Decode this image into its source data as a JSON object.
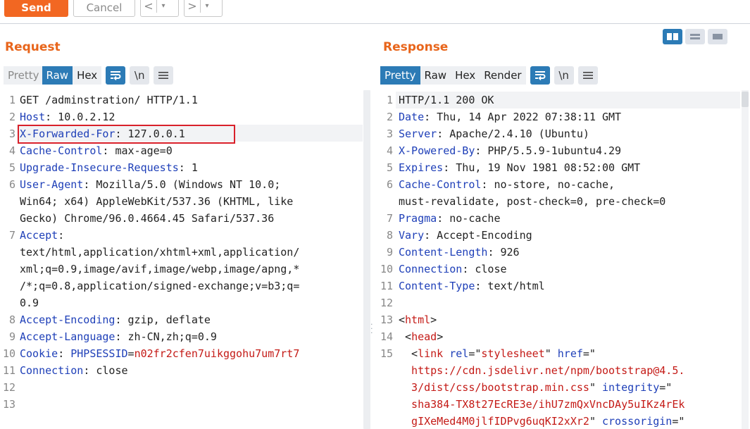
{
  "toolbar": {
    "send_label": "Send",
    "cancel_label": "Cancel",
    "back_icon": "<",
    "forward_icon": ">",
    "dropdown_icon": "▾"
  },
  "request": {
    "title": "Request",
    "tabs": {
      "pretty": "Pretty",
      "raw": "Raw",
      "hex": "Hex",
      "newline": "\\n"
    },
    "lines": [
      {
        "n": "1",
        "key": "",
        "val": "GET /adminstration/ HTTP/1.1"
      },
      {
        "n": "2",
        "key": "Host",
        "val": ": 10.0.2.12"
      },
      {
        "n": "3",
        "key": "X-Forwarded-For",
        "val": ": 127.0.0.1"
      },
      {
        "n": "4",
        "key": "Cache-Control",
        "val": ": max-age=0"
      },
      {
        "n": "5",
        "key": "Upgrade-Insecure-Requests",
        "val": ": 1"
      },
      {
        "n": "6",
        "key": "User-Agent",
        "val": ": Mozilla/5.0 (Windows NT 10.0;"
      },
      {
        "n": "",
        "key": "",
        "val": "Win64; x64) AppleWebKit/537.36 (KHTML, like"
      },
      {
        "n": "",
        "key": "",
        "val": "Gecko) Chrome/96.0.4664.45 Safari/537.36"
      },
      {
        "n": "7",
        "key": "Accept",
        "val": ":"
      },
      {
        "n": "",
        "key": "",
        "val": "text/html,application/xhtml+xml,application/"
      },
      {
        "n": "",
        "key": "",
        "val": "xml;q=0.9,image/avif,image/webp,image/apng,*"
      },
      {
        "n": "",
        "key": "",
        "val": "/*;q=0.8,application/signed-exchange;v=b3;q="
      },
      {
        "n": "",
        "key": "",
        "val": "0.9"
      },
      {
        "n": "8",
        "key": "Accept-Encoding",
        "val": ": gzip, deflate"
      },
      {
        "n": "9",
        "key": "Accept-Language",
        "val": ": zh-CN,zh;q=0.9"
      },
      {
        "n": "10",
        "key": "Cookie",
        "val": ": ",
        "cookie_name": "PHPSESSID",
        "cookie_eq": "=",
        "cookie_val": "n02fr2cfen7uikggohu7um7rt7"
      },
      {
        "n": "11",
        "key": "Connection",
        "val": ": close"
      },
      {
        "n": "12",
        "key": "",
        "val": ""
      },
      {
        "n": "13",
        "key": "",
        "val": ""
      }
    ]
  },
  "response": {
    "title": "Response",
    "tabs": {
      "pretty": "Pretty",
      "raw": "Raw",
      "hex": "Hex",
      "render": "Render",
      "newline": "\\n"
    },
    "lines": [
      {
        "n": "1",
        "key": "",
        "val": "HTTP/1.1 200 OK"
      },
      {
        "n": "2",
        "key": "Date",
        "val": ": Thu, 14 Apr 2022 07:38:11 GMT"
      },
      {
        "n": "3",
        "key": "Server",
        "val": ": Apache/2.4.10 (Ubuntu)"
      },
      {
        "n": "4",
        "key": "X-Powered-By",
        "val": ": PHP/5.5.9-1ubuntu4.29"
      },
      {
        "n": "5",
        "key": "Expires",
        "val": ": Thu, 19 Nov 1981 08:52:00 GMT"
      },
      {
        "n": "6",
        "key": "Cache-Control",
        "val": ": no-store, no-cache,"
      },
      {
        "n": "",
        "key": "",
        "val": "must-revalidate, post-check=0, pre-check=0"
      },
      {
        "n": "7",
        "key": "Pragma",
        "val": ": no-cache"
      },
      {
        "n": "8",
        "key": "Vary",
        "val": ": Accept-Encoding"
      },
      {
        "n": "9",
        "key": "Content-Length",
        "val": ": 926"
      },
      {
        "n": "10",
        "key": "Connection",
        "val": ": close"
      },
      {
        "n": "11",
        "key": "Content-Type",
        "val": ": text/html"
      },
      {
        "n": "12",
        "key": "",
        "val": ""
      },
      {
        "n": "13",
        "html": [
          {
            "c": "v",
            "t": "<"
          },
          {
            "c": "tag",
            "t": "html"
          },
          {
            "c": "v",
            "t": ">"
          }
        ]
      },
      {
        "n": "14",
        "html": [
          {
            "c": "v",
            "t": " <"
          },
          {
            "c": "tag",
            "t": "head"
          },
          {
            "c": "v",
            "t": ">"
          }
        ]
      },
      {
        "n": "15",
        "html": [
          {
            "c": "v",
            "t": "  <"
          },
          {
            "c": "tag",
            "t": "link"
          },
          {
            "c": "v",
            "t": " "
          },
          {
            "c": "attr",
            "t": "rel"
          },
          {
            "c": "v",
            "t": "=\""
          },
          {
            "c": "strv",
            "t": "stylesheet"
          },
          {
            "c": "v",
            "t": "\" "
          },
          {
            "c": "attr",
            "t": "href"
          },
          {
            "c": "v",
            "t": "=\""
          }
        ]
      },
      {
        "n": "",
        "html": [
          {
            "c": "strv",
            "t": "  https://cdn.jsdelivr.net/npm/bootstrap@4.5."
          }
        ]
      },
      {
        "n": "",
        "html": [
          {
            "c": "strv",
            "t": "  3/dist/css/bootstrap.min.css"
          },
          {
            "c": "v",
            "t": "\" "
          },
          {
            "c": "attr",
            "t": "integrity"
          },
          {
            "c": "v",
            "t": "=\""
          }
        ]
      },
      {
        "n": "",
        "html": [
          {
            "c": "strv",
            "t": "  sha384-TX8t27EcRE3e/ihU7zmQxVncDAy5uIKz4rEk"
          }
        ]
      },
      {
        "n": "",
        "html": [
          {
            "c": "strv",
            "t": "  gIXeMed4M0jlfIDPvg6uqKI2xXr2"
          },
          {
            "c": "v",
            "t": "\" "
          },
          {
            "c": "attr",
            "t": "crossorigin"
          },
          {
            "c": "v",
            "t": "=\""
          }
        ]
      }
    ]
  },
  "colors": {
    "accent_orange": "#f26722",
    "title_orange": "#e8651b",
    "active_blue": "#2c7bb6",
    "header_key_blue": "#1e3fb8",
    "value_red": "#c41a16",
    "highlight_box_red": "#d9202a"
  },
  "icons": {
    "wrap": "wrap-lines-icon",
    "menu": "hamburger-menu-icon",
    "layout_split": "layout-side-by-side-icon",
    "layout_stacked": "layout-stacked-icon",
    "layout_single": "layout-single-icon"
  }
}
